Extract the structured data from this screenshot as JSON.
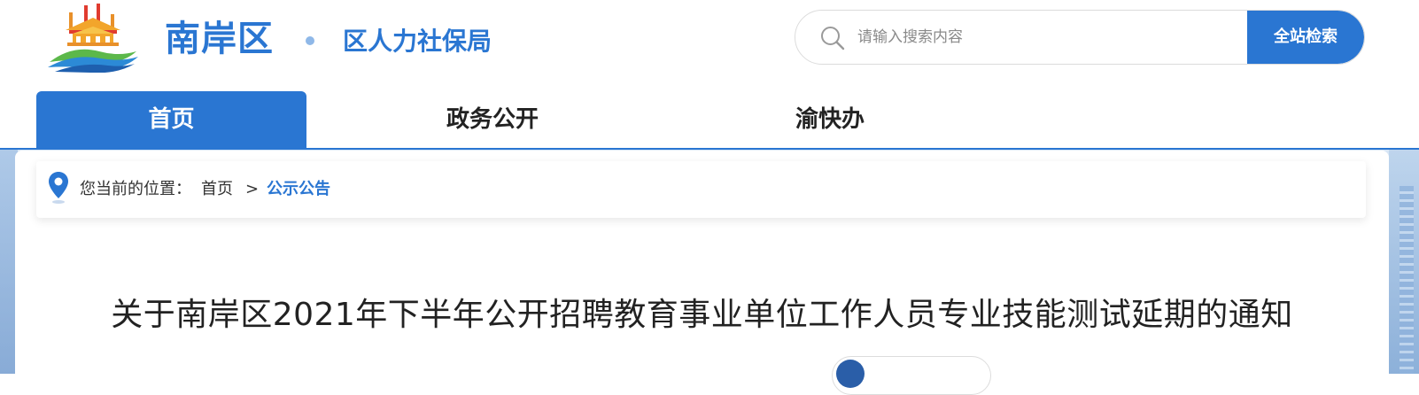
{
  "header": {
    "site_name": "南岸区",
    "dept_name": "区人力社保局",
    "logo_icon": "nanan-district-logo"
  },
  "search": {
    "placeholder": "请输入搜索内容",
    "value": "",
    "button_label": "全站检索",
    "icon": "search-icon"
  },
  "nav": {
    "items": [
      {
        "label": "首页",
        "active": true
      },
      {
        "label": "政务公开",
        "active": false
      },
      {
        "label": "渝快办",
        "active": false
      }
    ]
  },
  "breadcrumb": {
    "icon": "location-pin-icon",
    "prefix": "您当前的位置：",
    "home": "首页",
    "separator": ">",
    "current": "公示公告"
  },
  "article": {
    "title": "关于南岸区2021年下半年公开招聘教育事业单位工作人员专业技能测试延期的通知"
  },
  "colors": {
    "accent": "#2a76d2",
    "text": "#222222",
    "muted": "#8a8a8a",
    "background": "#d7e6f6"
  }
}
